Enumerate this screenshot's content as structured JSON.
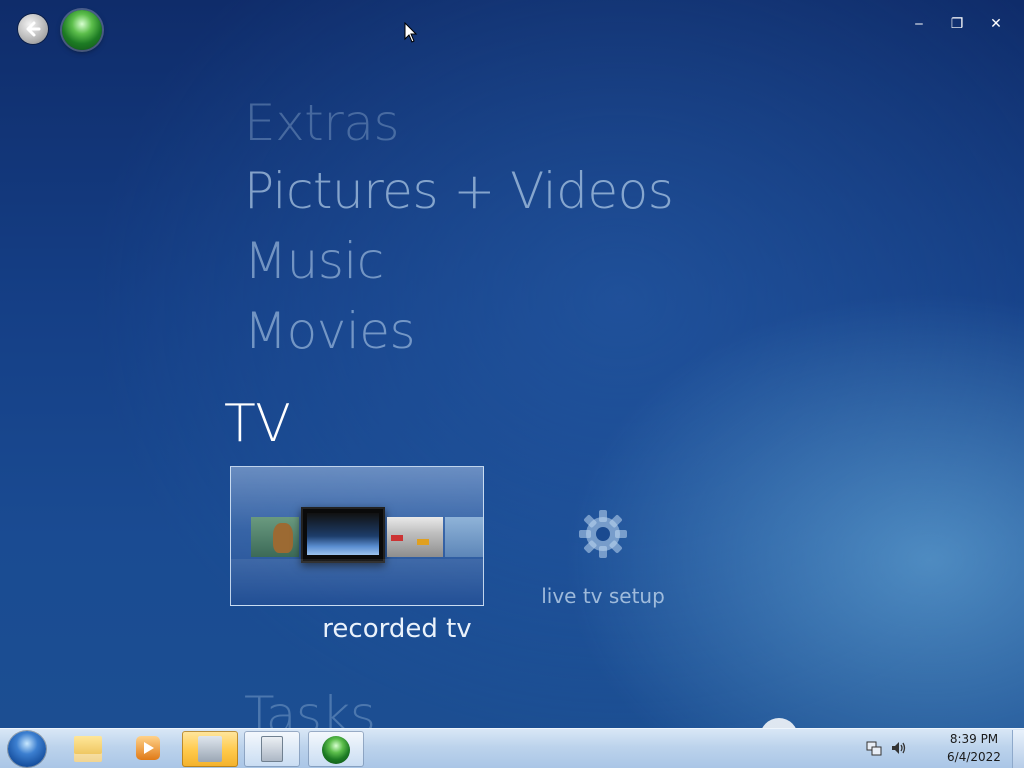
{
  "window": {
    "controls": {
      "minimize": "‒",
      "restore": "❐",
      "close": "✕"
    }
  },
  "menu": {
    "items": [
      {
        "label": "Extras"
      },
      {
        "label": "Pictures + Videos"
      },
      {
        "label": "Music"
      },
      {
        "label": "Movies"
      },
      {
        "label": "TV",
        "selected": true
      },
      {
        "label": "Tasks"
      }
    ]
  },
  "tv_strip": {
    "tiles": [
      {
        "label": "recorded tv",
        "focused": true
      },
      {
        "label": "live tv setup",
        "icon": "gear-icon"
      }
    ]
  },
  "taskbar": {
    "items": [
      "start-orb",
      "windows-explorer",
      "windows-media-player",
      "devices-and-printers",
      "calculator",
      "windows-media-center"
    ],
    "clock": {
      "time": "8:39 PM",
      "date": "6/4/2022"
    },
    "tray_icons": [
      "network-icon",
      "volume-icon"
    ]
  },
  "colors": {
    "background": "#153f86",
    "menu_selected": "#ffffff",
    "taskbar": "#bcd3ec"
  }
}
